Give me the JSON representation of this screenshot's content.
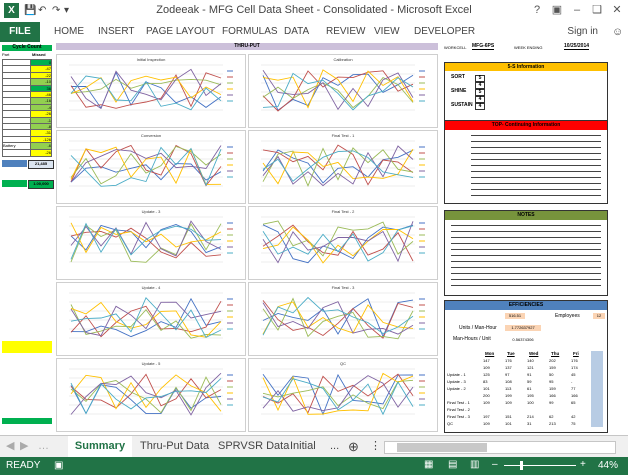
{
  "app": {
    "title": "Zodeeak - MFG Cell Data Sheet - Consolidated - Microsoft Excel",
    "logo": "X",
    "signin": "Sign in"
  },
  "ribbon": {
    "file": "FILE",
    "tabs": [
      "HOME",
      "INSERT",
      "PAGE LAYOUT",
      "FORMULAS",
      "DATA",
      "REVIEW",
      "VIEW",
      "DEVELOPER"
    ]
  },
  "left": {
    "header1": "Cycle Count",
    "col1": "Part",
    "col2": "Missed",
    "rows": [
      [
        "",
        "0"
      ],
      [
        "",
        "-47"
      ],
      [
        "",
        "-22"
      ],
      [
        "",
        "-10"
      ],
      [
        "",
        "36"
      ],
      [
        "",
        "-46"
      ],
      [
        "",
        "-16"
      ],
      [
        "",
        "-4"
      ],
      [
        "",
        "-26"
      ],
      [
        "",
        "-1"
      ],
      [
        "",
        "-8"
      ],
      [
        "",
        "-31"
      ],
      [
        "",
        "-126"
      ],
      [
        "Battery",
        "-6"
      ],
      [
        "",
        "-26"
      ]
    ],
    "box1_label": "",
    "box1_value": "21,485",
    "box2_label": "",
    "box2_value": "1.00,000",
    "bottom_label": ""
  },
  "center": {
    "header": "THRU-PUT",
    "charts": [
      {
        "title": "Initial Inspection"
      },
      {
        "title": "Calibration"
      },
      {
        "title": "Conversion"
      },
      {
        "title": "Final Test - 1"
      },
      {
        "title": "Update - 3"
      },
      {
        "title": "Final Test - 2"
      },
      {
        "title": "Update - 4"
      },
      {
        "title": "Final Test - 3"
      },
      {
        "title": "Update - 5"
      },
      {
        "title": "QC"
      }
    ]
  },
  "right": {
    "workcell_label": "WORKCELL",
    "workcell_value": "MFG-6PS",
    "weekending_label": "WEEK ENDING",
    "weekending_value": "10/25/2014",
    "fives_title": "5-S Information",
    "fives": [
      [
        "SORT",
        "5"
      ],
      [
        "",
        "4"
      ],
      [
        "SHINE",
        "5"
      ],
      [
        "",
        "4"
      ],
      [
        "SUSTAIN",
        "4"
      ]
    ],
    "issues_title": "TOP- Continuing Information",
    "notes_title": "NOTES",
    "eff_title": "EFFICIENCIES",
    "eff_rows": [
      {
        "label": "",
        "value": "516.51",
        "label2": "Employees",
        "value2": "12"
      },
      {
        "label": "Units / Man-Hour",
        "value": "1.772637927",
        "label2": "",
        "value2": ""
      },
      {
        "label": "Man-Hours / Unit",
        "value": "0.56374306",
        "label2": "",
        "": ""
      }
    ],
    "days": [
      "Mon",
      "Tue",
      "Wed",
      "Thu",
      "Fri"
    ],
    "table_rows": [
      [
        "",
        "147",
        "176",
        "140",
        "202",
        "176"
      ],
      [
        "",
        "109",
        "137",
        "121",
        "159",
        "174"
      ],
      [
        "Update - 1",
        "125",
        "97",
        "91",
        "50",
        "45"
      ],
      [
        "Update - 3",
        "83",
        "108",
        "59",
        "95",
        "-"
      ],
      [
        "Update - 2",
        "101",
        "113",
        "61",
        "159",
        "77"
      ],
      [
        "",
        "200",
        "199",
        "195",
        "166",
        "166"
      ],
      [
        "Final Test - 1",
        "109",
        "109",
        "100",
        "99",
        "65"
      ],
      [
        "Final Test - 2",
        "",
        "",
        "",
        "",
        ""
      ],
      [
        "Final Test - 3",
        "197",
        "151",
        "214",
        "62",
        "42"
      ],
      [
        "QC",
        "109",
        "101",
        "31",
        "213",
        "75"
      ]
    ]
  },
  "sheets": {
    "tabs": [
      "Summary",
      "Thru-Put Data",
      "SPRVSR Data",
      "Initial"
    ],
    "more": "..."
  },
  "status": {
    "ready": "READY",
    "zoom": "44%"
  },
  "colors": {
    "excel_green": "#217346",
    "cycle_green": "#00b050",
    "yellow": "#ffc000",
    "red": "#ff0000",
    "olive": "#77933c",
    "blue_header": "#4f81bd",
    "lightblue": "#dbe5f1",
    "purple": "#ccc0da"
  }
}
